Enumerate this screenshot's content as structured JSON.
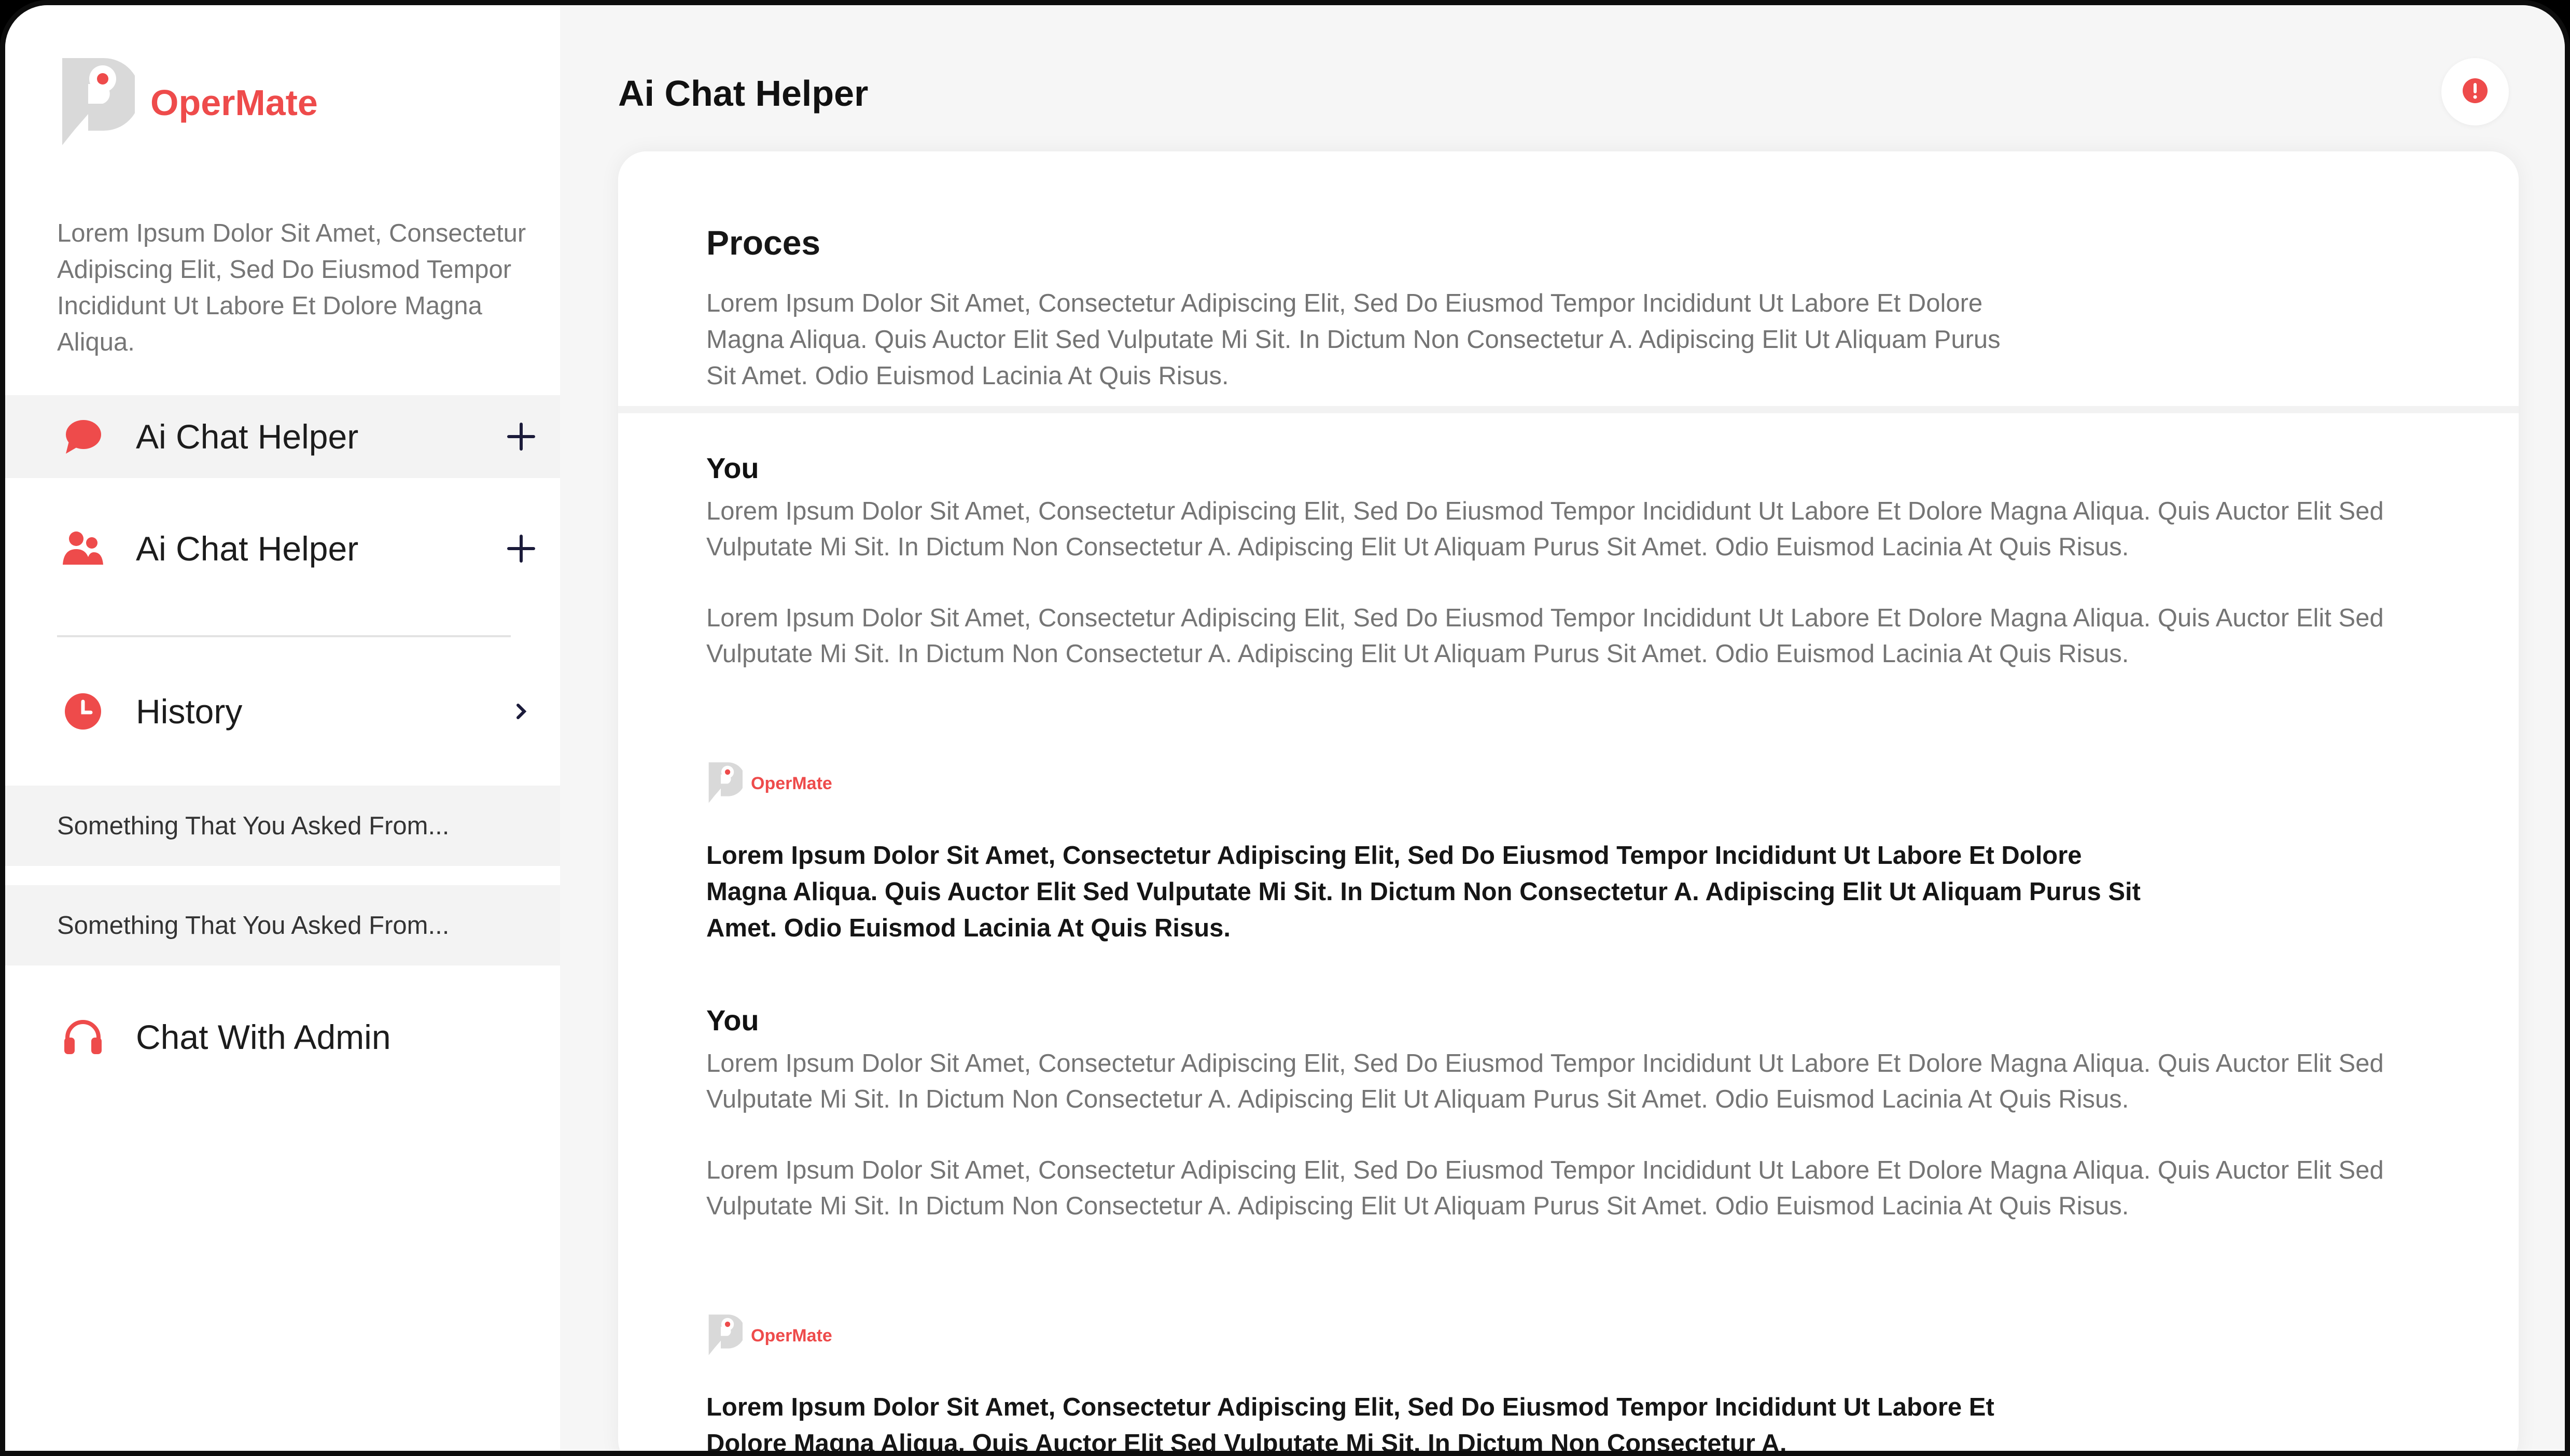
{
  "brand": {
    "name": "OperMate",
    "description": "Lorem Ipsum Dolor Sit Amet, Consectetur Adipiscing Elit, Sed Do Eiusmod Tempor Incididunt Ut Labore Et Dolore Magna Aliqua."
  },
  "sidebar": {
    "items": [
      {
        "label": "Ai Chat Helper",
        "icon": "chat-bubble-icon",
        "action": "plus-icon"
      },
      {
        "label": "Ai Chat Helper",
        "icon": "users-icon",
        "action": "plus-icon"
      },
      {
        "label": "History",
        "icon": "clock-icon",
        "action": "chevron-right-icon"
      }
    ],
    "history": [
      "Something That You Asked From...",
      "Something That You Asked From..."
    ],
    "chat_admin": {
      "label": "Chat With Admin",
      "icon": "headset-icon"
    }
  },
  "main": {
    "title": "Ai Chat Helper",
    "alert_icon": "alert-icon",
    "proces": {
      "title": "Proces",
      "text": "Lorem Ipsum Dolor Sit Amet, Consectetur Adipiscing Elit, Sed Do Eiusmod Tempor Incididunt Ut Labore Et Dolore Magna Aliqua. Quis Auctor Elit Sed Vulputate Mi Sit. In Dictum Non Consectetur A. Adipiscing Elit Ut Aliquam Purus Sit Amet. Odio Euismod Lacinia At Quis Risus."
    },
    "messages": [
      {
        "author": "You",
        "para1": "Lorem Ipsum Dolor Sit Amet, Consectetur Adipiscing Elit, Sed Do Eiusmod Tempor Incididunt Ut Labore Et Dolore Magna Aliqua. Quis Auctor Elit Sed Vulputate Mi Sit. In Dictum Non Consectetur A. Adipiscing Elit Ut Aliquam Purus Sit Amet. Odio Euismod Lacinia At Quis Risus.",
        "para2": "Lorem Ipsum Dolor Sit Amet, Consectetur Adipiscing Elit, Sed Do Eiusmod Tempor Incididunt Ut Labore Et Dolore Magna Aliqua. Quis Auctor Elit Sed Vulputate Mi Sit. In Dictum Non Consectetur A. Adipiscing Elit Ut Aliquam Purus Sit Amet. Odio Euismod Lacinia At Quis Risus."
      },
      {
        "author": "OperMate",
        "text": "Lorem Ipsum Dolor Sit Amet, Consectetur Adipiscing Elit, Sed Do Eiusmod Tempor Incididunt Ut Labore Et Dolore Magna Aliqua. Quis Auctor Elit Sed Vulputate Mi Sit. In Dictum Non Consectetur A. Adipiscing Elit Ut Aliquam Purus Sit Amet. Odio Euismod Lacinia At Quis Risus."
      },
      {
        "author": "You",
        "para1": "Lorem Ipsum Dolor Sit Amet, Consectetur Adipiscing Elit, Sed Do Eiusmod Tempor Incididunt Ut Labore Et Dolore Magna Aliqua. Quis Auctor Elit Sed Vulputate Mi Sit. In Dictum Non Consectetur A. Adipiscing Elit Ut Aliquam Purus Sit Amet. Odio Euismod Lacinia At Quis Risus.",
        "para2": "Lorem Ipsum Dolor Sit Amet, Consectetur Adipiscing Elit, Sed Do Eiusmod Tempor Incididunt Ut Labore Et Dolore Magna Aliqua. Quis Auctor Elit Sed Vulputate Mi Sit. In Dictum Non Consectetur A. Adipiscing Elit Ut Aliquam Purus Sit Amet. Odio Euismod Lacinia At Quis Risus."
      },
      {
        "author": "OperMate",
        "text": "Lorem Ipsum Dolor Sit Amet, Consectetur Adipiscing Elit, Sed Do Eiusmod Tempor Incididunt Ut Labore Et Dolore Magna Aliqua. Quis Auctor Elit Sed Vulputate Mi Sit. In Dictum Non Consectetur A."
      }
    ]
  },
  "colors": {
    "accent": "#ee4b4b",
    "logo_gray": "#d6d6d6",
    "nav_active_bg": "#f3f3f3",
    "main_bg": "#f6f6f6"
  }
}
